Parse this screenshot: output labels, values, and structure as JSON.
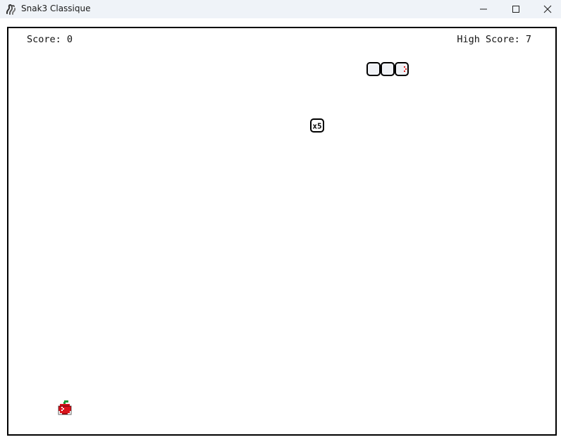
{
  "window": {
    "title": "Snak3 Classique",
    "icon": "snake-logo-icon",
    "controls": [
      "minimize-icon",
      "maximize-icon",
      "close-icon"
    ]
  },
  "hud": {
    "score_text": "Score: 0",
    "high_score_text": "High Score: 7"
  },
  "game": {
    "snake": {
      "length": 3,
      "direction": "right",
      "head_color": "#e11d1d"
    },
    "powerup": {
      "label": "x5",
      "icon": "multiplier-token-icon"
    },
    "food": {
      "type": "apple",
      "icon": "apple-icon",
      "color": "#d9141c",
      "leaf_color": "#1f9a3a"
    }
  },
  "colors": {
    "board_border": "#000000",
    "segment_fill": "#f0f2f6",
    "titlebar_bg": "#eff3f8"
  }
}
